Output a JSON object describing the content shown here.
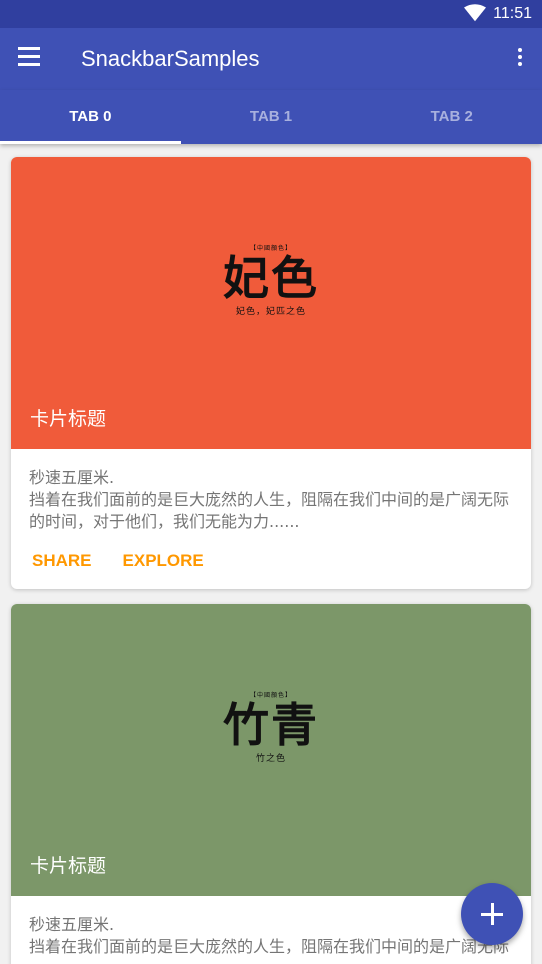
{
  "status_bar": {
    "time": "11:51",
    "wifi_icon": "wifi-icon"
  },
  "app_bar": {
    "title": "SnackbarSamples",
    "menu_icon": "menu-icon",
    "more_icon": "more-vert-icon"
  },
  "tabs": [
    {
      "label": "TAB 0",
      "selected": true
    },
    {
      "label": "TAB 1",
      "selected": false
    },
    {
      "label": "TAB 2",
      "selected": false
    }
  ],
  "cards": [
    {
      "media_color": "#f05b3a",
      "logo_tag": "【中國顏色】",
      "logo_text": "妃色",
      "logo_sub": "妃色，妃匹之色",
      "title": "卡片标题",
      "subtitle": "秒速五厘米.",
      "body": "挡着在我们面前的是巨大庞然的人生，阻隔在我们中间的是广阔无际的时间，对于他们，我们无能为力......",
      "actions": [
        "SHARE",
        "EXPLORE"
      ]
    },
    {
      "media_color": "#7c9769",
      "logo_tag": "【中國顏色】",
      "logo_text": "竹青",
      "logo_sub": "竹之色",
      "title": "卡片标题",
      "subtitle": "秒速五厘米.",
      "body": "挡着在我们面前的是巨大庞然的人生，阻隔在我们中间的是广阔无际"
    }
  ],
  "fab": {
    "icon": "add-icon"
  },
  "colors": {
    "primary": "#3f51b5",
    "primary_dark": "#303f9f",
    "accent": "#ff9800"
  }
}
